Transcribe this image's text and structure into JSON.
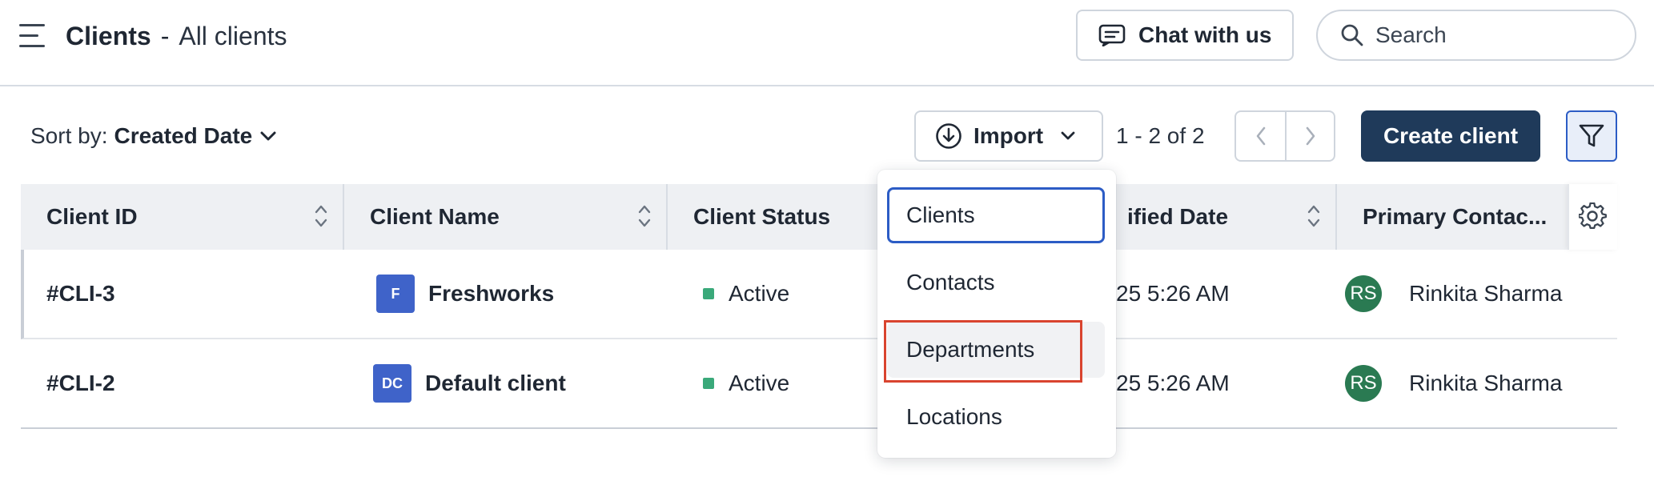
{
  "header": {
    "title": "Clients",
    "separator": "-",
    "subtitle": "All clients",
    "chat_label": "Chat with us",
    "search_placeholder": "Search"
  },
  "toolbar": {
    "sort_label": "Sort by:",
    "sort_value": "Created Date",
    "import_label": "Import",
    "pagination": "1 - 2 of 2",
    "create_label": "Create client"
  },
  "table": {
    "columns": [
      {
        "label": "Client ID"
      },
      {
        "label": "Client Name"
      },
      {
        "label": "Client Status"
      },
      {
        "label": "ified Date"
      },
      {
        "label": "Primary Contac..."
      }
    ],
    "rows": [
      {
        "id": "#CLI-3",
        "logo": "F",
        "name": "Freshworks",
        "status": "Active",
        "date": "25 5:26 AM",
        "initials": "RS",
        "contact": "Rinkita Sharma"
      },
      {
        "id": "#CLI-2",
        "logo": "DC",
        "name": "Default client",
        "status": "Active",
        "date": "25 5:26 AM",
        "initials": "RS",
        "contact": "Rinkita Sharma"
      }
    ]
  },
  "import_menu": {
    "items": [
      {
        "label": "Clients"
      },
      {
        "label": "Contacts"
      },
      {
        "label": "Departments"
      },
      {
        "label": "Locations"
      }
    ]
  },
  "colors": {
    "primary": "#1f3a5a",
    "focus": "#2c5cc5",
    "status_active": "#3aa97a",
    "avatar": "#2a7a52",
    "highlight": "#d9442f"
  }
}
